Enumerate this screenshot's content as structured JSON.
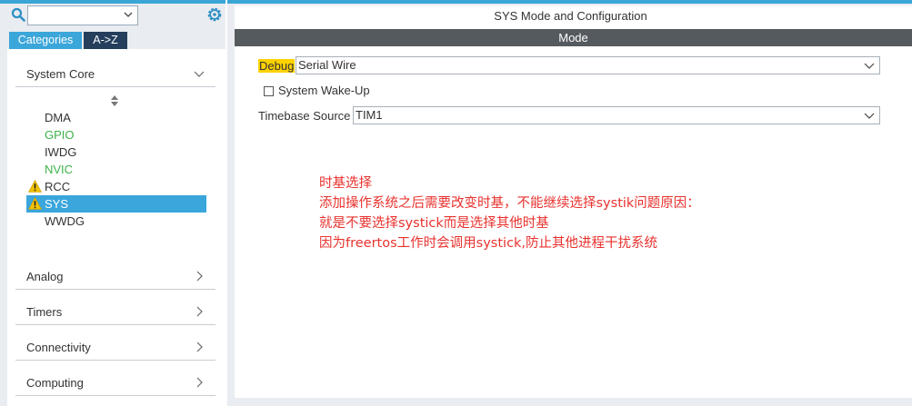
{
  "left": {
    "search": {
      "value": "",
      "placeholder": ""
    },
    "tabs": [
      {
        "label": "Categories"
      },
      {
        "label": "A->Z"
      }
    ],
    "categories": [
      {
        "label": "System Core",
        "expanded": true
      },
      {
        "label": "Analog"
      },
      {
        "label": "Timers"
      },
      {
        "label": "Connectivity"
      },
      {
        "label": "Computing"
      }
    ],
    "system_core_items": [
      {
        "label": "DMA",
        "color": "normal",
        "warning": false
      },
      {
        "label": "GPIO",
        "color": "green",
        "warning": false
      },
      {
        "label": "IWDG",
        "color": "normal",
        "warning": false
      },
      {
        "label": "NVIC",
        "color": "green",
        "warning": false
      },
      {
        "label": "RCC",
        "color": "normal",
        "warning": true
      },
      {
        "label": "SYS",
        "color": "normal",
        "warning": true,
        "selected": true
      },
      {
        "label": "WWDG",
        "color": "normal",
        "warning": false
      }
    ]
  },
  "right": {
    "title": "SYS Mode and Configuration",
    "mode_header": "Mode",
    "debug": {
      "label": "Debug",
      "value": "Serial Wire"
    },
    "wakeup": {
      "label": "System Wake-Up",
      "checked": false
    },
    "timebase": {
      "label": "Timebase Source",
      "value": "TIM1"
    },
    "notes": [
      "时基选择",
      "添加操作系统之后需要改变时基，不能继续选择systik问题原因：",
      "就是不要选择systick而是选择其他时基",
      "因为freertos工作时会调用systick,防止其他进程干扰系统"
    ]
  },
  "colors": {
    "accent": "#39a6d6",
    "selected": "#3aa6dc",
    "tab_dark": "#243e5c",
    "mode_bar": "#555a5f",
    "note_red": "#e8322e",
    "green_item": "#3db34a",
    "debug_highlight": "#ffd200",
    "warning": "#f2c200"
  }
}
